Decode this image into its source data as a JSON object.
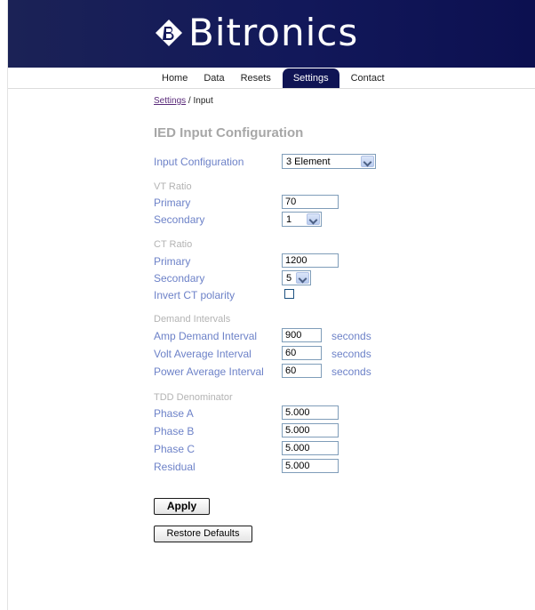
{
  "header": {
    "brand": "Bitronics",
    "logo_icon": "bitronics-diamond-logo",
    "bg_color": "#12185a"
  },
  "nav": {
    "tabs": [
      {
        "label": "Home",
        "active": false
      },
      {
        "label": "Data",
        "active": false
      },
      {
        "label": "Resets",
        "active": false
      },
      {
        "label": "Settings",
        "active": true
      },
      {
        "label": "Contact",
        "active": false
      }
    ],
    "active_color": "#0f1454"
  },
  "breadcrumb": {
    "link": "Settings",
    "separator": " / ",
    "current": "Input"
  },
  "page": {
    "title": "IED Input Configuration"
  },
  "form": {
    "input_configuration": {
      "label": "Input Configuration",
      "value": "3 Element"
    },
    "vt_ratio": {
      "heading": "VT Ratio",
      "primary": {
        "label": "Primary",
        "value": "70"
      },
      "secondary": {
        "label": "Secondary",
        "value": "1"
      }
    },
    "ct_ratio": {
      "heading": "CT Ratio",
      "primary": {
        "label": "Primary",
        "value": "1200"
      },
      "secondary": {
        "label": "Secondary",
        "value": "5"
      },
      "invert": {
        "label": "Invert CT polarity",
        "checked": false
      }
    },
    "demand": {
      "heading": "Demand Intervals",
      "amp": {
        "label": "Amp Demand Interval",
        "value": "900",
        "unit": "seconds"
      },
      "volt": {
        "label": "Volt Average Interval",
        "value": "60",
        "unit": "seconds"
      },
      "power": {
        "label": "Power Average Interval",
        "value": "60",
        "unit": "seconds"
      }
    },
    "tdd": {
      "heading": "TDD Denominator",
      "phase_a": {
        "label": "Phase A",
        "value": "5.000"
      },
      "phase_b": {
        "label": "Phase B",
        "value": "5.000"
      },
      "phase_c": {
        "label": "Phase C",
        "value": "5.000"
      },
      "residual": {
        "label": "Residual",
        "value": "5.000"
      }
    }
  },
  "buttons": {
    "apply": "Apply",
    "restore": "Restore Defaults"
  },
  "colors": {
    "label": "#6d82c8",
    "heading": "#b3b3b3",
    "title": "#a7a7a7"
  }
}
